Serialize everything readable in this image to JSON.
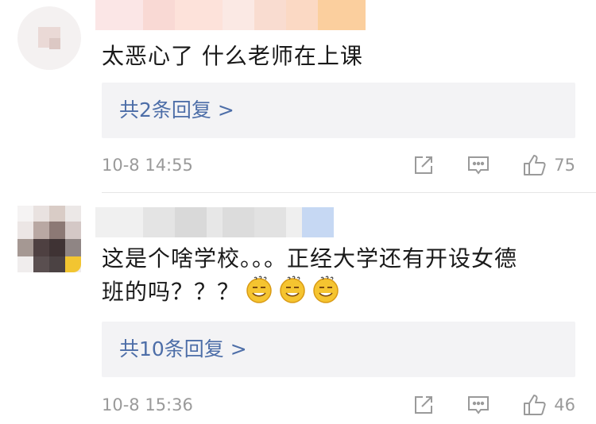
{
  "comments": [
    {
      "text": "太恶心了 什么老师在上课",
      "replies_label": "共2条回复 >",
      "timestamp": "10-8 14:55",
      "likes": "75"
    },
    {
      "text_line1": "这是个啥学校。。。正经大学还有开设女德",
      "text_line2": "班的吗？？？",
      "replies_label": "共10条回复 >",
      "timestamp": "10-8 15:36",
      "likes": "46"
    }
  ],
  "icons": {
    "share": "share-icon",
    "reply": "comment-icon",
    "like": "thumbs-up-icon",
    "emoji": "sweat-smile-emoji"
  },
  "colors": {
    "reply_link": "#4d6ea8",
    "meta_gray": "#9a9a9a",
    "reply_box_bg": "#f3f3f5"
  }
}
